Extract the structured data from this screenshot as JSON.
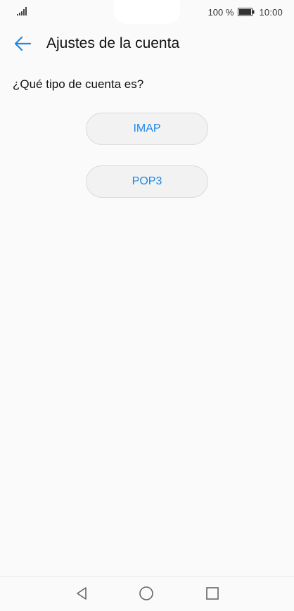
{
  "status_bar": {
    "battery_percent": "100 %",
    "time": "10:00",
    "signal_icon": "signal-bars-icon",
    "battery_icon": "battery-full-icon"
  },
  "header": {
    "title": "Ajustes de la cuenta",
    "back_icon": "arrow-left-icon",
    "accent_color": "#1e88e5"
  },
  "main": {
    "question": "¿Qué tipo de cuenta es?",
    "options": [
      {
        "label": "IMAP"
      },
      {
        "label": "POP3"
      }
    ]
  },
  "nav_bar": {
    "back_icon": "triangle-back-icon",
    "home_icon": "circle-home-icon",
    "recent_icon": "square-recents-icon"
  }
}
